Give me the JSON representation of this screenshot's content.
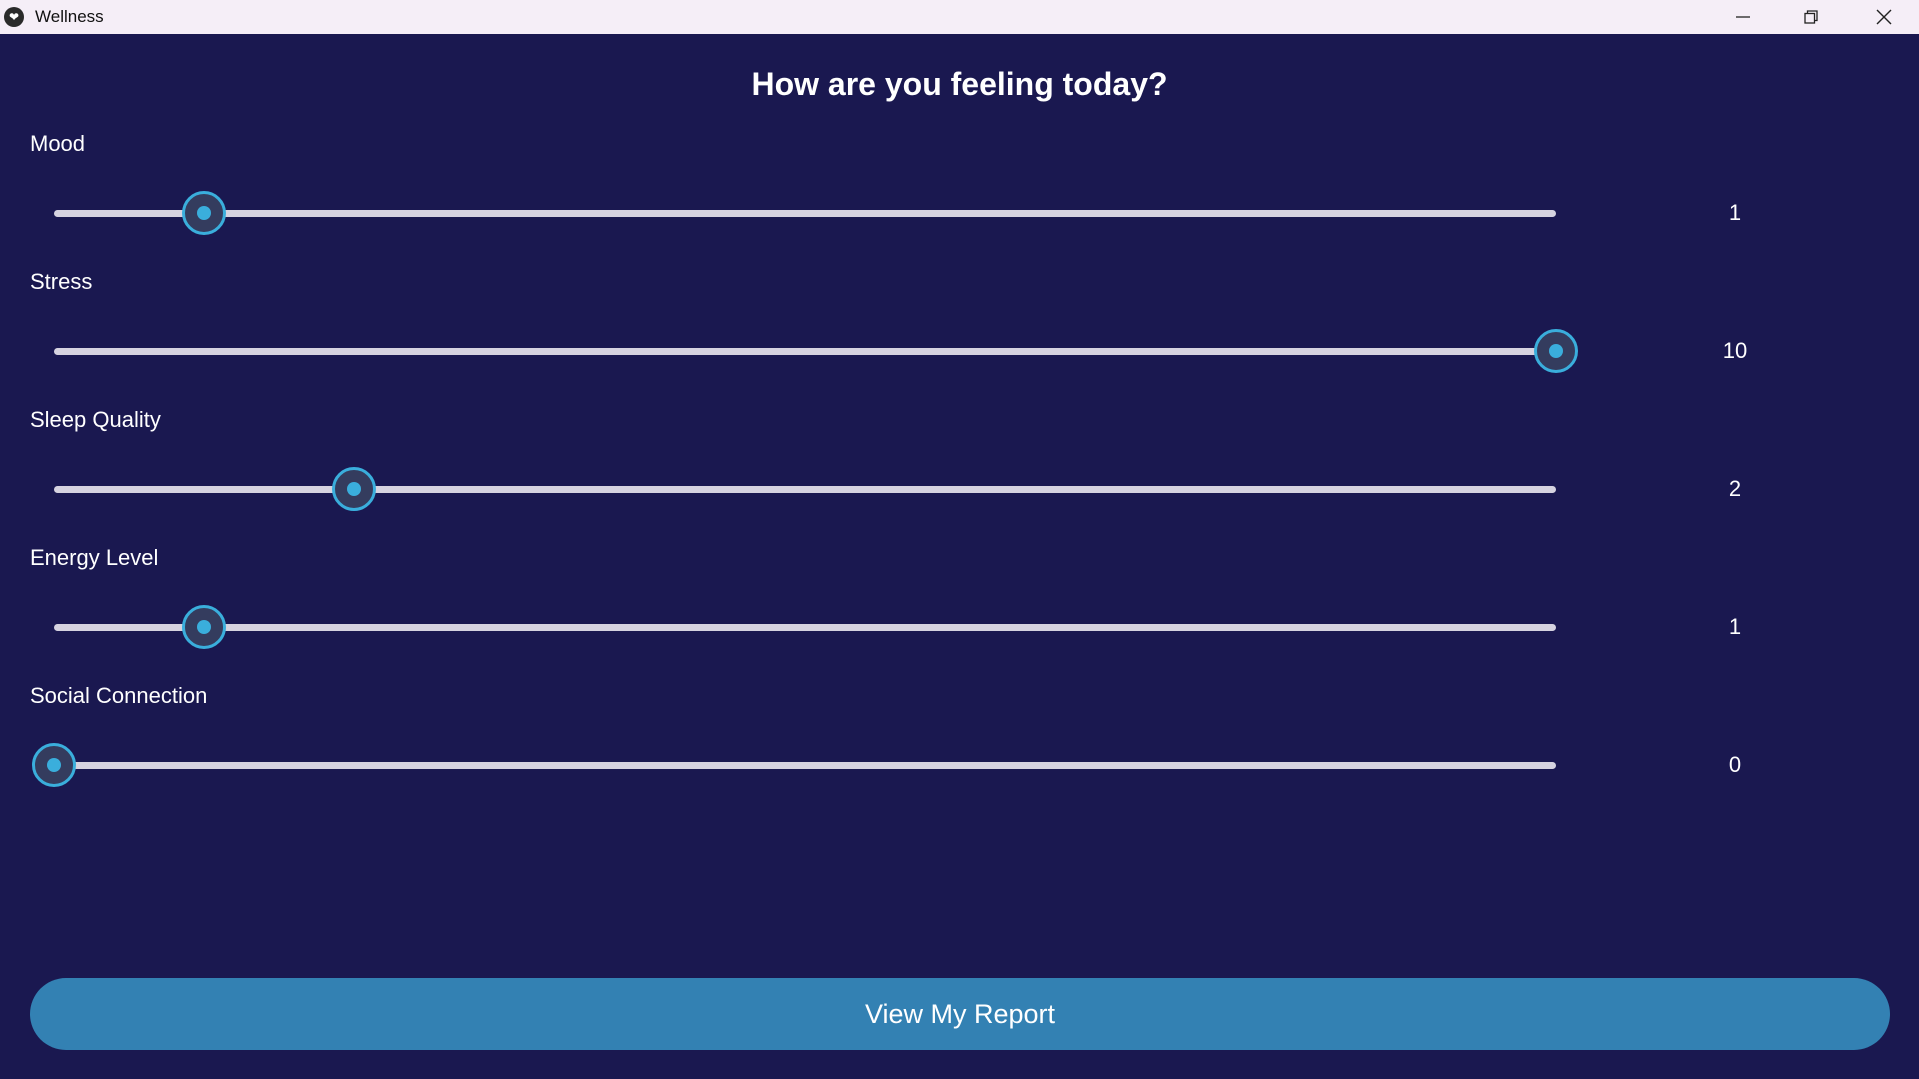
{
  "window": {
    "title": "Wellness",
    "icon": "app-logo-icon",
    "controls": [
      "minimize-icon",
      "restore-icon",
      "close-icon"
    ]
  },
  "heading": "How are you feeling today?",
  "sliders": [
    {
      "label": "Mood",
      "value": "1",
      "level": 1,
      "max": 10
    },
    {
      "label": "Stress",
      "value": "10",
      "level": 10,
      "max": 10
    },
    {
      "label": "Sleep Quality",
      "value": "2",
      "level": 2,
      "max": 10
    },
    {
      "label": "Energy Level",
      "value": "1",
      "level": 1,
      "max": 10
    },
    {
      "label": "Social Connection",
      "value": "0",
      "level": 0,
      "max": 10
    }
  ],
  "report_button": "View My Report",
  "colors": {
    "background": "#1a1850",
    "accent": "#3aaedc",
    "button": "#3381b3",
    "titlebar": "#f5eef7"
  }
}
